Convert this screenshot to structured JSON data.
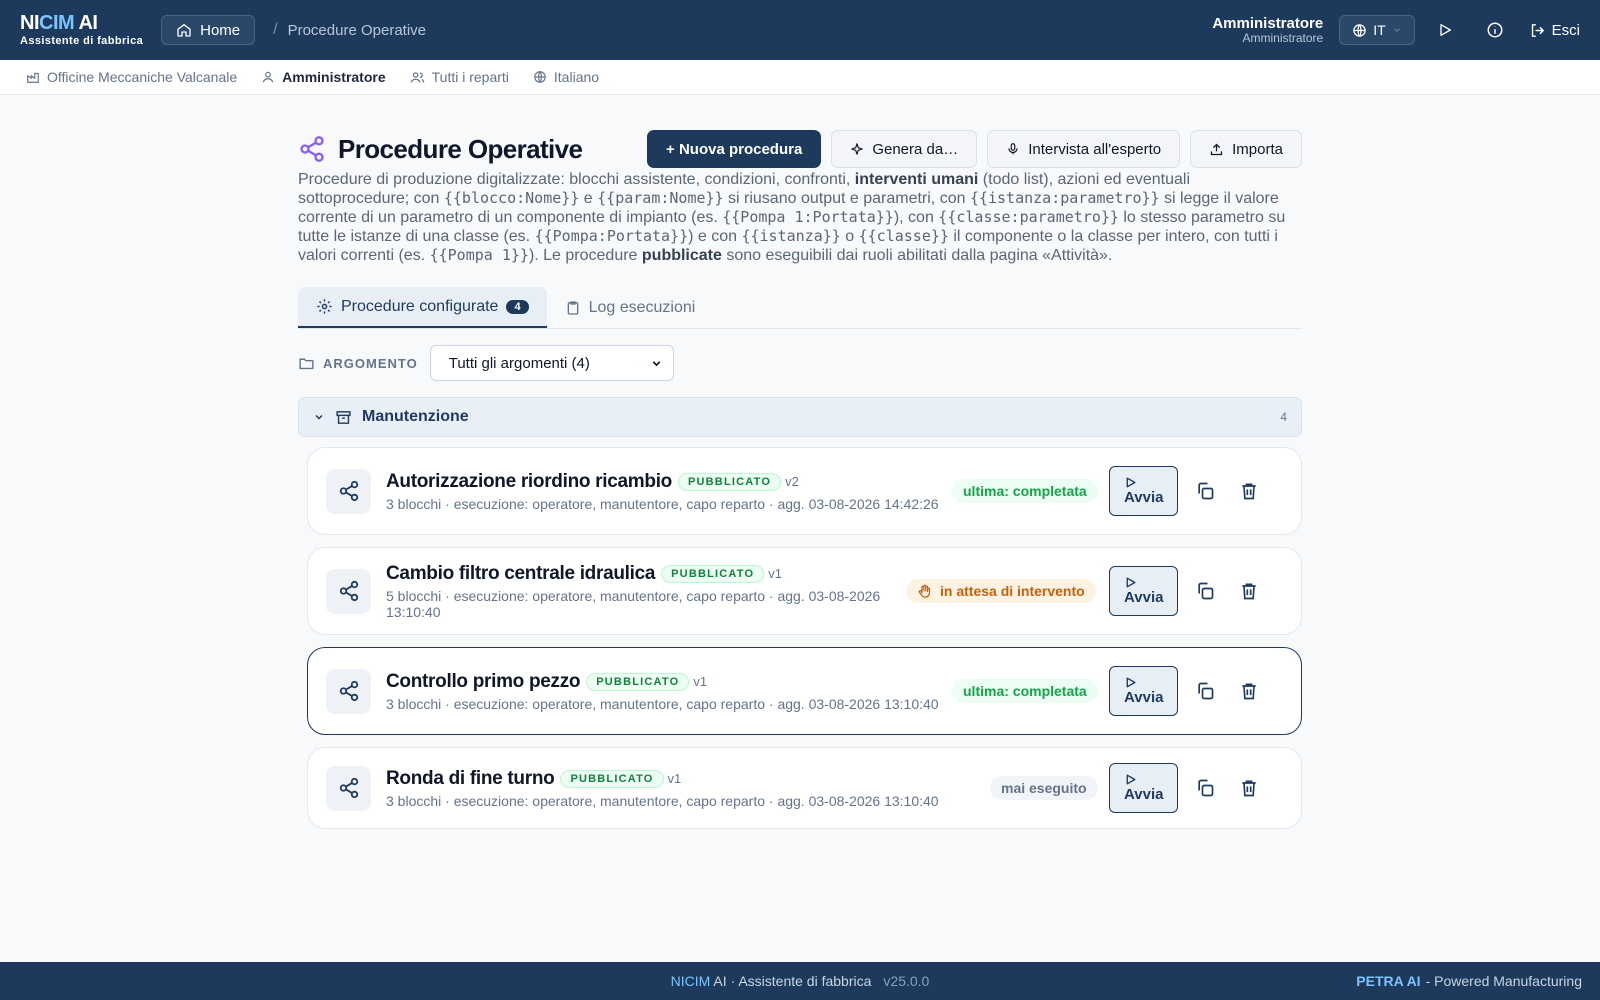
{
  "brand": {
    "prefix": "NI",
    "highlight": "CIM",
    "suffix": " AI",
    "subtitle": "Assistente di fabbrica"
  },
  "header": {
    "home_label": "Home",
    "breadcrumb_sep": "/",
    "breadcrumb_current": "Procedure Operative",
    "user_name": "Amministratore",
    "user_role": "Amministratore",
    "language": "IT",
    "logout_label": "Esci"
  },
  "subbar": {
    "company": "Officine Meccaniche Valcanale",
    "user": "Amministratore",
    "departments": "Tutti i reparti",
    "language": "Italiano"
  },
  "page": {
    "title": "Procedure Operative",
    "actions": {
      "new": "+ Nuova procedura",
      "generate": "Genera da…",
      "interview": "Intervista all'esperto",
      "import": "Importa"
    },
    "description": {
      "t1": "Procedure di produzione digitalizzate: blocchi assistente, condizioni, confronti, ",
      "b1": "interventi umani",
      "t2": " (todo list), azioni ed eventuali sottoprocedure; con ",
      "c1": "{{blocco:Nome}}",
      "t3": " e ",
      "c2": "{{param:Nome}}",
      "t4": " si riusano output e parametri, con ",
      "c3": "{{istanza:parametro}}",
      "t5": " si legge il valore corrente di un parametro di un componente di impianto (es. ",
      "c4": "{{Pompa 1:Portata}}",
      "t6": "), con ",
      "c5": "{{classe:parametro}}",
      "t7": " lo stesso parametro su tutte le istanze di una classe (es. ",
      "c6": "{{Pompa:Portata}}",
      "t8": ") e con ",
      "c7": "{{istanza}}",
      "t9": " o ",
      "c8": "{{classe}}",
      "t10": " il componente o la classe per intero, con tutti i valori correnti (es. ",
      "c9": "{{Pompa 1}}",
      "t11": "). Le procedure ",
      "b2": "pubblicate",
      "t12": " sono eseguibili dai ruoli abilitati dalla pagina «Attività»."
    }
  },
  "tabs": [
    {
      "label": "Procedure configurate",
      "count": "4"
    },
    {
      "label": "Log esecuzioni"
    }
  ],
  "filter": {
    "label": "ARGOMENTO",
    "selected": "Tutti gli argomenti (4)"
  },
  "group": {
    "title": "Manutenzione",
    "count": "4"
  },
  "procedures": [
    {
      "title": "Autorizzazione riordino ricambio",
      "badge": "PUBBLICATO",
      "version": "v2",
      "meta": "3 blocchi · esecuzione: operatore, manutentore, capo reparto · agg. 03-08-2026 14:42:26",
      "status": "ultima: completata",
      "run": "Avvia"
    },
    {
      "title": "Cambio filtro centrale idraulica",
      "badge": "PUBBLICATO",
      "version": "v1",
      "meta": "5 blocchi · esecuzione: operatore, manutentore, capo reparto · agg. 03-08-2026 13:10:40",
      "status": "in attesa di intervento",
      "run": "Avvia"
    },
    {
      "title": "Controllo primo pezzo",
      "badge": "PUBBLICATO",
      "version": "v1",
      "meta": "3 blocchi · esecuzione: operatore, manutentore, capo reparto · agg. 03-08-2026 13:10:40",
      "status": "ultima: completata",
      "run": "Avvia"
    },
    {
      "title": "Ronda di fine turno",
      "badge": "PUBBLICATO",
      "version": "v1",
      "meta": "3 blocchi · esecuzione: operatore, manutentore, capo reparto · agg. 03-08-2026 13:10:40",
      "status": "mai eseguito",
      "run": "Avvia"
    }
  ],
  "footer": {
    "highlight": "NICIM",
    "text": " AI · Assistente di fabbrica",
    "version": "v25.0.0",
    "right_brand": "PETRA AI",
    "right_text": "- Powered Manufacturing"
  },
  "colors": {
    "navy": "#1d3a5c",
    "accent": "#7cc4ff",
    "success": "#16a34a",
    "warning": "#c2620c",
    "procedure_icon": "#8b5cf6"
  }
}
